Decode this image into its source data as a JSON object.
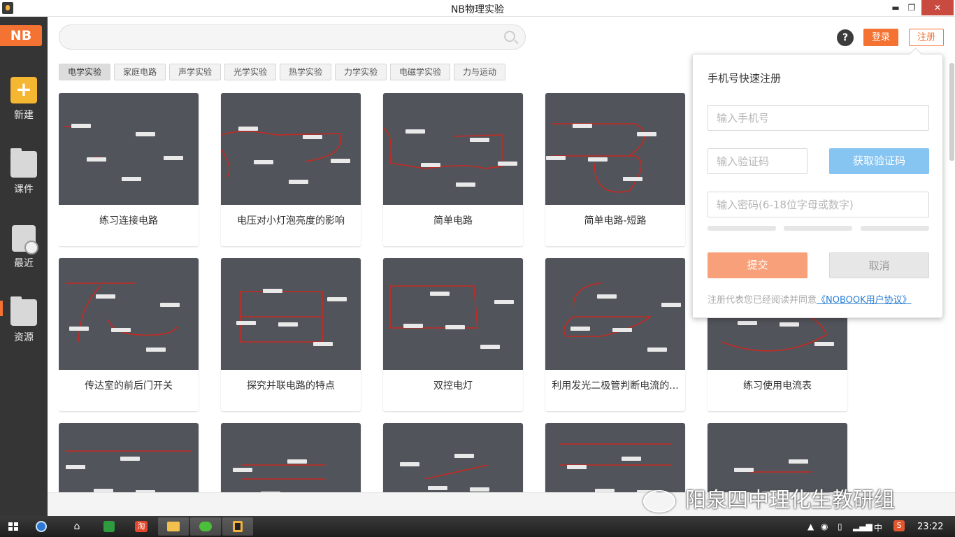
{
  "window": {
    "title": "NB物理实验",
    "minimize": "▬",
    "maximize": "❐",
    "close": "✕"
  },
  "sidebar": {
    "logo": "NB",
    "items": [
      {
        "label": "新建",
        "icon": "plus-icon"
      },
      {
        "label": "课件",
        "icon": "folder-icon"
      },
      {
        "label": "最近",
        "icon": "recent-doc-icon"
      },
      {
        "label": "资源",
        "icon": "folder-icon"
      }
    ]
  },
  "search": {
    "placeholder": "",
    "value": ""
  },
  "header": {
    "help": "?",
    "login": "登录",
    "register": "注册"
  },
  "categories": [
    {
      "label": "电学实验",
      "active": true
    },
    {
      "label": "家庭电路",
      "active": false
    },
    {
      "label": "声学实验",
      "active": false
    },
    {
      "label": "光学实验",
      "active": false
    },
    {
      "label": "热学实验",
      "active": false
    },
    {
      "label": "力学实验",
      "active": false
    },
    {
      "label": "电磁学实验",
      "active": false
    },
    {
      "label": "力与运动",
      "active": false
    }
  ],
  "cards": [
    {
      "title": "练习连接电路"
    },
    {
      "title": "电压对小灯泡亮度的影响"
    },
    {
      "title": "简单电路"
    },
    {
      "title": "简单电路-短路"
    },
    {
      "title": ""
    },
    {
      "title": "传达室的前后门开关"
    },
    {
      "title": "探究并联电路的特点"
    },
    {
      "title": "双控电灯"
    },
    {
      "title": "利用发光二极管判断电流的..."
    },
    {
      "title": "练习使用电流表"
    },
    {
      "title": ""
    },
    {
      "title": ""
    },
    {
      "title": ""
    },
    {
      "title": ""
    },
    {
      "title": ""
    }
  ],
  "register_panel": {
    "title": "手机号快速注册",
    "phone_placeholder": "输入手机号",
    "code_placeholder": "输入验证码",
    "get_code": "获取验证码",
    "password_placeholder": "输入密码(6-18位字母或数字)",
    "submit": "提交",
    "cancel": "取消",
    "agree_text": "注册代表您已经阅读并同意",
    "agreement_link": "《NOBOOK用户协议》"
  },
  "watermark": {
    "text": "阳泉四中理化生教研组"
  },
  "taskbar": {
    "apps": [
      "home-icon",
      "green-app-icon",
      "taobao-icon",
      "file-explorer-icon",
      "wechat-icon",
      "nb-app-icon"
    ],
    "taobao_label": "淘",
    "lang": "中",
    "ime": "S",
    "time": "23:22"
  },
  "colors": {
    "accent": "#f47232",
    "sidebar": "#353535",
    "thumb": "#51545a",
    "wire": "#c62a23",
    "getcode": "#86c4f1",
    "link": "#2a7fd4"
  }
}
